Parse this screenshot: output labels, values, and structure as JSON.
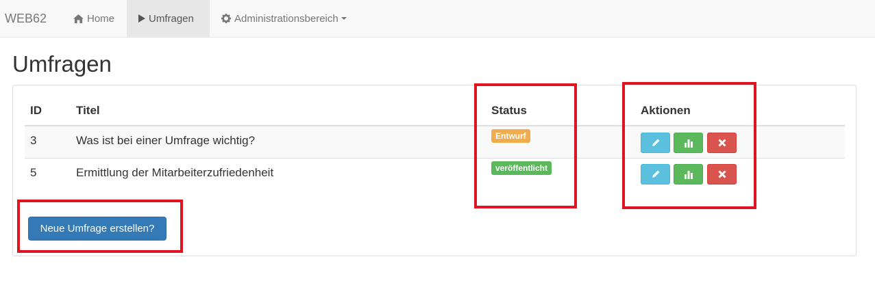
{
  "navbar": {
    "brand": "WEB62",
    "items": [
      {
        "label": "Home",
        "icon": "home-icon"
      },
      {
        "label": "Umfragen",
        "icon": "play-icon"
      },
      {
        "label": "Administrationsbereich",
        "icon": "gear-icon"
      }
    ]
  },
  "page": {
    "title": "Umfragen"
  },
  "table": {
    "headers": [
      "ID",
      "Titel",
      "Status",
      "Aktionen"
    ],
    "rows": [
      {
        "id": "3",
        "title": "Was ist bei einer Umfrage wichtig?",
        "status": "Entwurf"
      },
      {
        "id": "5",
        "title": "Ermittlung der Mitarbeiterzufriedenheit",
        "status": "veröffentlicht"
      }
    ],
    "actions": [
      "pencil-icon",
      "bar-chart-icon",
      "remove-icon"
    ]
  },
  "buttons": {
    "new_survey": "Neue Umfrage erstellen?"
  },
  "colors": {
    "primary": "#337ab7",
    "info": "#5bc0de",
    "success": "#5cb85c",
    "danger": "#d9534f",
    "warning": "#f0ad4e",
    "highlight": "#e0141e"
  }
}
